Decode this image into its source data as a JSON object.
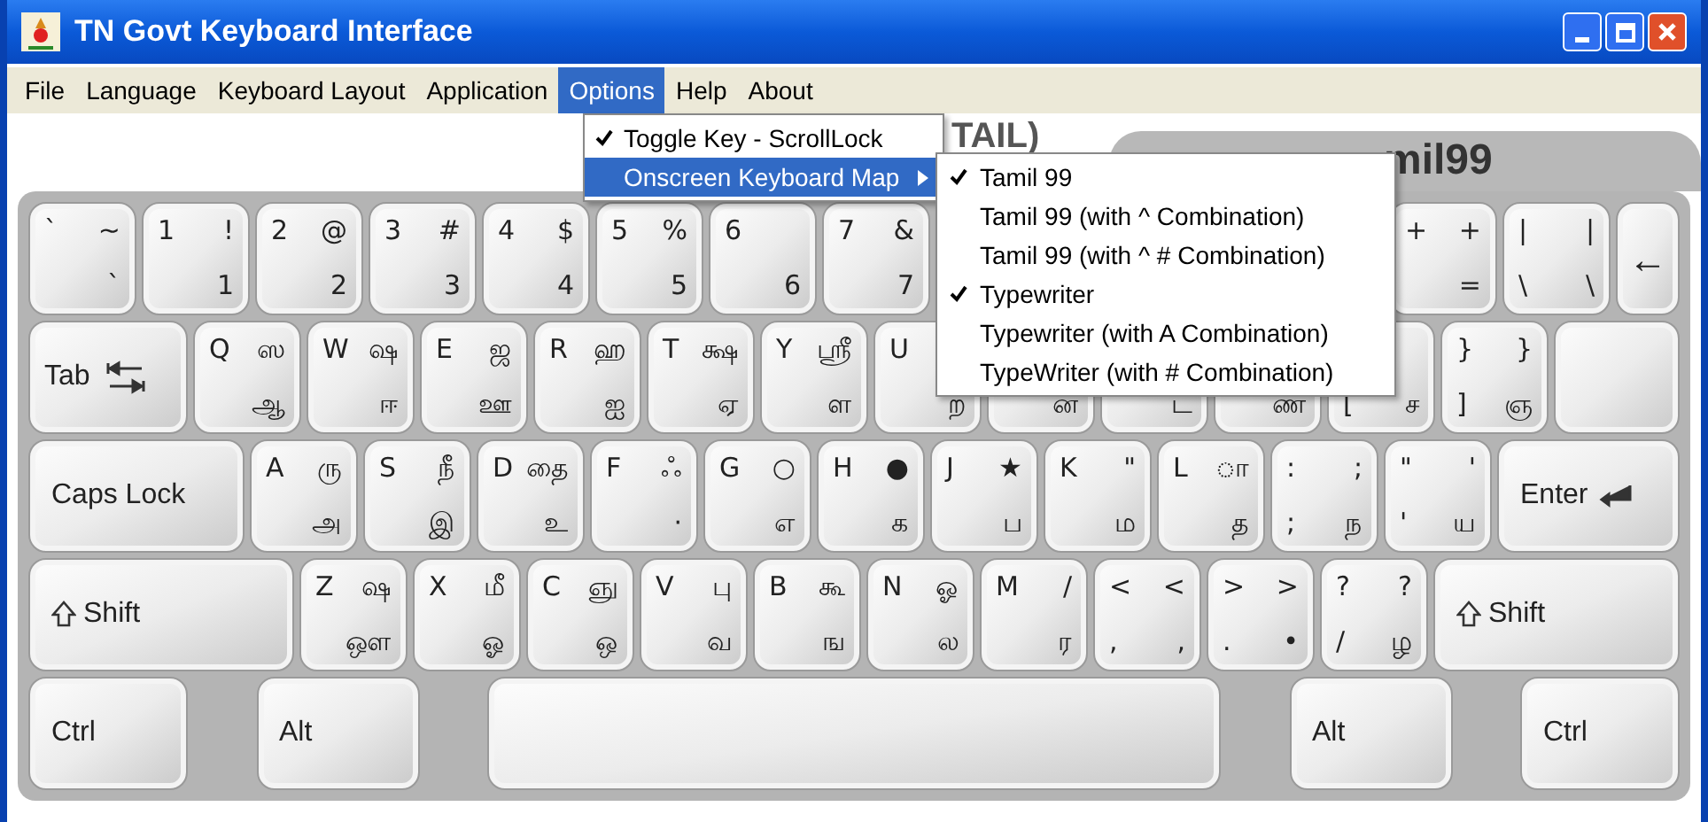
{
  "window": {
    "title": "TN Govt Keyboard Interface"
  },
  "menu_bar": [
    {
      "label": "File",
      "selected": false
    },
    {
      "label": "Language",
      "selected": false
    },
    {
      "label": "Keyboard Layout",
      "selected": false
    },
    {
      "label": "Application",
      "selected": false
    },
    {
      "label": "Options",
      "selected": true
    },
    {
      "label": "Help",
      "selected": false
    },
    {
      "label": "About",
      "selected": false
    }
  ],
  "header": {
    "left_text": "TAIL)",
    "right_tab": "mil99"
  },
  "keyboard": [
    [
      {
        "kind": "char",
        "tl": "`",
        "tr": "~",
        "br": "`"
      },
      {
        "kind": "char",
        "tl": "1",
        "tr": "!",
        "br": "1"
      },
      {
        "kind": "char",
        "tl": "2",
        "tr": "@",
        "br": "2"
      },
      {
        "kind": "char",
        "tl": "3",
        "tr": "#",
        "br": "3"
      },
      {
        "kind": "char",
        "tl": "4",
        "tr": "$",
        "br": "4"
      },
      {
        "kind": "char",
        "tl": "5",
        "tr": "%",
        "br": "5"
      },
      {
        "kind": "char",
        "tl": "6",
        "br": "6"
      },
      {
        "kind": "char",
        "tl": "7",
        "tr": "&",
        "br": "7"
      },
      {
        "kind": "char"
      },
      {
        "kind": "char"
      },
      {
        "kind": "char"
      },
      {
        "kind": "char"
      },
      {
        "kind": "char",
        "tl": "+",
        "tr": "+",
        "br": "="
      },
      {
        "kind": "char",
        "tl": "|",
        "tr": "|",
        "bl": "\\",
        "br": "\\"
      },
      {
        "kind": "backspace",
        "label": "←"
      }
    ],
    [
      {
        "kind": "tab",
        "label": "Tab"
      },
      {
        "kind": "char",
        "tl": "Q",
        "tr": "ஸ",
        "br": "ஆ"
      },
      {
        "kind": "char",
        "tl": "W",
        "tr": "ஷ",
        "br": "ஈ"
      },
      {
        "kind": "char",
        "tl": "E",
        "tr": "ஜ",
        "br": "ஊ"
      },
      {
        "kind": "char",
        "tl": "R",
        "tr": "ஹ",
        "br": "ஐ"
      },
      {
        "kind": "char",
        "tl": "T",
        "tr": "க்ஷ",
        "br": "ஏ"
      },
      {
        "kind": "char",
        "tl": "Y",
        "tr": "ஸ்ரீ",
        "br": "ள"
      },
      {
        "kind": "char",
        "tl": "U",
        "br": "ற"
      },
      {
        "kind": "char",
        "br": "ன"
      },
      {
        "kind": "char",
        "br": "ட"
      },
      {
        "kind": "char",
        "br": "ண"
      },
      {
        "kind": "char",
        "bl": "[",
        "br": "ச"
      },
      {
        "kind": "char",
        "tl": "}",
        "tr": "}",
        "bl": "]",
        "br": "ஞ"
      },
      {
        "kind": "enter_top"
      }
    ],
    [
      {
        "kind": "caps",
        "label": "Caps Lock"
      },
      {
        "kind": "char",
        "tl": "A",
        "tr": "ரு",
        "br": "அ"
      },
      {
        "kind": "char",
        "tl": "S",
        "tr": "நீ",
        "br": "இ"
      },
      {
        "kind": "char",
        "tl": "D",
        "tr": "தை",
        "br": "உ"
      },
      {
        "kind": "char",
        "tl": "F",
        "tr": "ஃ",
        "br": "·"
      },
      {
        "kind": "char",
        "tl": "G",
        "tr": "○",
        "br": "எ"
      },
      {
        "kind": "char",
        "tl": "H",
        "tr": "●",
        "br": "க"
      },
      {
        "kind": "char",
        "tl": "J",
        "tr": "★",
        "br": "ப"
      },
      {
        "kind": "char",
        "tl": "K",
        "tr": "\"",
        "br": "ம"
      },
      {
        "kind": "char",
        "tl": "L",
        "tr": "ா",
        "br": "த"
      },
      {
        "kind": "char",
        "tl": ":",
        "tr": ";",
        "bl": ";",
        "br": "ந"
      },
      {
        "kind": "char",
        "tl": "\"",
        "tr": "'",
        "bl": "'",
        "br": "ய"
      },
      {
        "kind": "enter",
        "label": "Enter"
      }
    ],
    [
      {
        "kind": "shift",
        "label": "Shift"
      },
      {
        "kind": "char",
        "tl": "Z",
        "tr": "ஷ",
        "br": "ஔ"
      },
      {
        "kind": "char",
        "tl": "X",
        "tr": "மீ",
        "br": "ஓ"
      },
      {
        "kind": "char",
        "tl": "C",
        "tr": "ஞு",
        "br": "ஒ"
      },
      {
        "kind": "char",
        "tl": "V",
        "tr": "பு",
        "br": "வ"
      },
      {
        "kind": "char",
        "tl": "B",
        "tr": "கூ",
        "br": "ங"
      },
      {
        "kind": "char",
        "tl": "N",
        "tr": "ஓ",
        "br": "ல"
      },
      {
        "kind": "char",
        "tl": "M",
        "tr": "/",
        "br": "ர"
      },
      {
        "kind": "char",
        "tl": "<",
        "tr": "<",
        "bl": ",",
        "br": ","
      },
      {
        "kind": "char",
        "tl": ">",
        "tr": ">",
        "bl": ".",
        "br": "•"
      },
      {
        "kind": "char",
        "tl": "?",
        "tr": "?",
        "bl": "/",
        "br": "ழ"
      },
      {
        "kind": "shift",
        "label": "Shift"
      }
    ],
    [
      {
        "kind": "ctrl",
        "label": "Ctrl"
      },
      {
        "kind": "alt",
        "label": "Alt"
      },
      {
        "kind": "space"
      },
      {
        "kind": "alt",
        "label": "Alt"
      },
      {
        "kind": "ctrl",
        "label": "Ctrl"
      }
    ]
  ],
  "options_menu": [
    {
      "label": "Toggle Key - ScrollLock",
      "checked": true,
      "selected": false,
      "submenu": false
    },
    {
      "label": "Onscreen Keyboard Map",
      "checked": false,
      "selected": true,
      "submenu": true
    }
  ],
  "keyboard_map_menu": [
    {
      "label": "Tamil 99",
      "checked": true
    },
    {
      "label": "Tamil 99 (with ^ Combination)",
      "checked": false
    },
    {
      "label": "Tamil 99 (with ^ # Combination)",
      "checked": false
    },
    {
      "label": "Typewriter",
      "checked": true
    },
    {
      "label": "Typewriter (with A Combination)",
      "checked": false
    },
    {
      "label": "TypeWriter (with # Combination)",
      "checked": false
    }
  ]
}
